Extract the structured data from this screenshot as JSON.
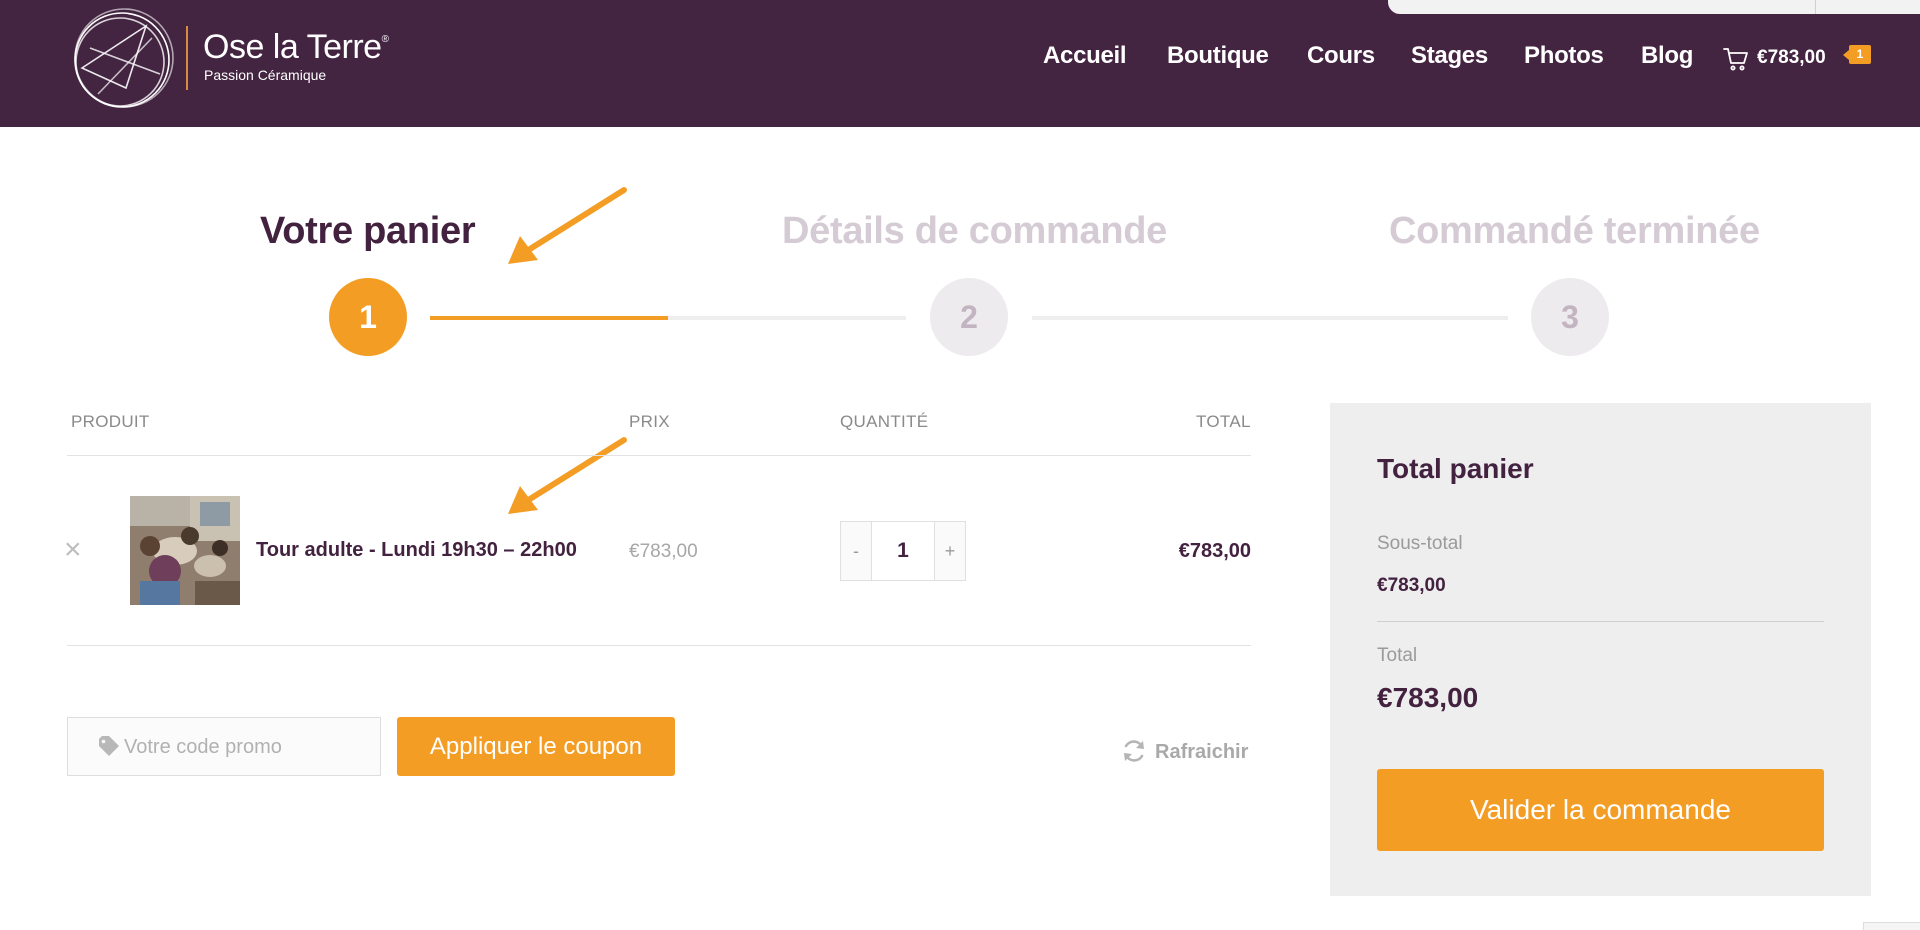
{
  "header": {
    "logo": {
      "title": "Ose la Terre",
      "registered": "®",
      "subtitle": "Passion Céramique"
    },
    "nav": [
      {
        "label": "Accueil"
      },
      {
        "label": "Boutique"
      },
      {
        "label": "Cours"
      },
      {
        "label": "Stages"
      },
      {
        "label": "Photos"
      },
      {
        "label": "Blog"
      }
    ],
    "cart": {
      "icon": "cart-icon",
      "total": "€783,00",
      "count": "1"
    }
  },
  "steps": [
    {
      "title": "Votre panier",
      "number": "1",
      "state": "active"
    },
    {
      "title": "Détails de commande",
      "number": "2",
      "state": "inactive"
    },
    {
      "title": "Commandé terminée",
      "number": "3",
      "state": "inactive"
    }
  ],
  "progress": {
    "first_segment_fill": 0.5
  },
  "table": {
    "headers": {
      "product": "PRODUIT",
      "price": "PRIX",
      "quantity": "QUANTITÉ",
      "total": "TOTAL"
    },
    "rows": [
      {
        "remove": "×",
        "name": "Tour adulte - Lundi 19h30 – 22h00",
        "price": "€783,00",
        "qty_minus": "-",
        "quantity": "1",
        "qty_plus": "+",
        "total": "€783,00"
      }
    ]
  },
  "coupon": {
    "icon": "tag-icon",
    "placeholder": "Votre code promo",
    "apply_label": "Appliquer le coupon",
    "refresh_icon": "refresh-icon",
    "refresh_label": "Rafraichir"
  },
  "totals": {
    "title": "Total panier",
    "subtotal_label": "Sous-total",
    "subtotal_value": "€783,00",
    "total_label": "Total",
    "total_value": "€783,00",
    "checkout_label": "Valider la commande"
  },
  "colors": {
    "header_bg": "#432441",
    "accent": "#f49d25",
    "text_dark": "#432240",
    "inactive_step": "#d5cbd4",
    "panel_bg": "#eeeeee"
  }
}
